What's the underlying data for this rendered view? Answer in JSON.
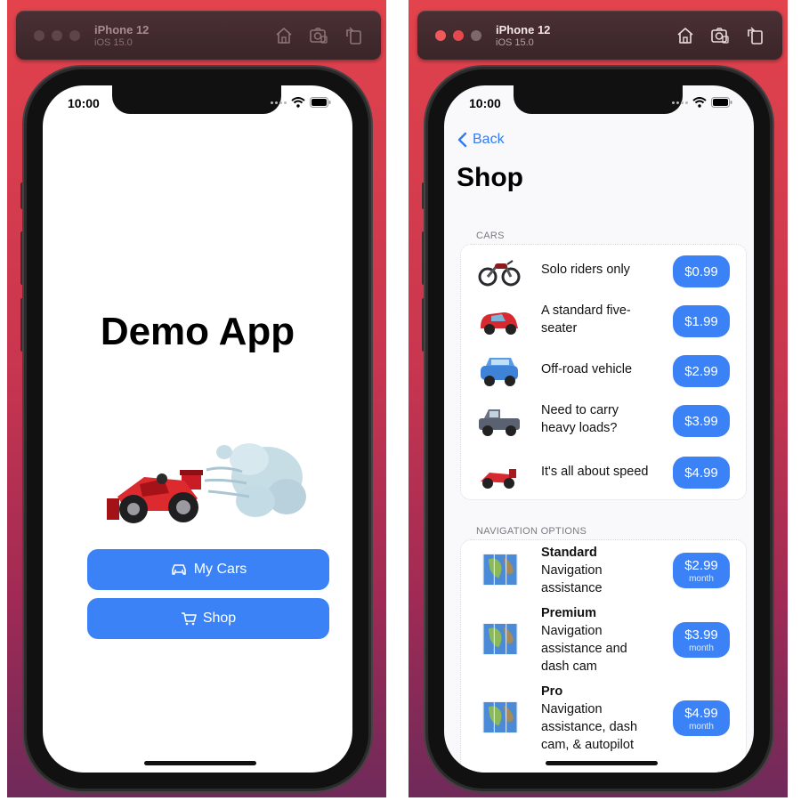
{
  "left_window": {
    "device_name": "iPhone 12",
    "os_version": "iOS 15.0",
    "status_time": "10:00",
    "app_title": "Demo App",
    "buttons": [
      {
        "label": "My Cars",
        "icon": "car-icon"
      },
      {
        "label": "Shop",
        "icon": "cart-icon"
      }
    ]
  },
  "right_window": {
    "device_name": "iPhone 12",
    "os_version": "iOS 15.0",
    "status_time": "10:00",
    "back_label": "Back",
    "page_title": "Shop",
    "cars_section": {
      "header": "CARS",
      "items": [
        {
          "icon": "motorcycle-icon",
          "description": "Solo riders only",
          "price": "$0.99"
        },
        {
          "icon": "red-car-icon",
          "description": "A standard five-seater",
          "price": "$1.99"
        },
        {
          "icon": "blue-suv-icon",
          "description": "Off-road vehicle",
          "price": "$2.99"
        },
        {
          "icon": "pickup-truck-icon",
          "description": "Need to carry heavy loads?",
          "price": "$3.99"
        },
        {
          "icon": "race-car-icon",
          "description": "It's all about speed",
          "price": "$4.99"
        }
      ]
    },
    "navigation_section": {
      "header": "NAVIGATION OPTIONS",
      "items": [
        {
          "icon": "map-icon",
          "title": "Standard",
          "description": "Navigation assistance",
          "price": "$2.99",
          "period": "month"
        },
        {
          "icon": "map-icon",
          "title": "Premium",
          "description": "Navigation assistance and dash cam",
          "price": "$3.99",
          "period": "month"
        },
        {
          "icon": "map-icon",
          "title": "Pro",
          "description": "Navigation assistance, dash cam, & autopilot",
          "price": "$4.99",
          "period": "month"
        }
      ]
    }
  },
  "colors": {
    "accent": "#3b82f6",
    "back_link": "#2f7cf6",
    "background_gradient_top": "#e2434c",
    "background_gradient_bottom": "#6f2a5a"
  }
}
